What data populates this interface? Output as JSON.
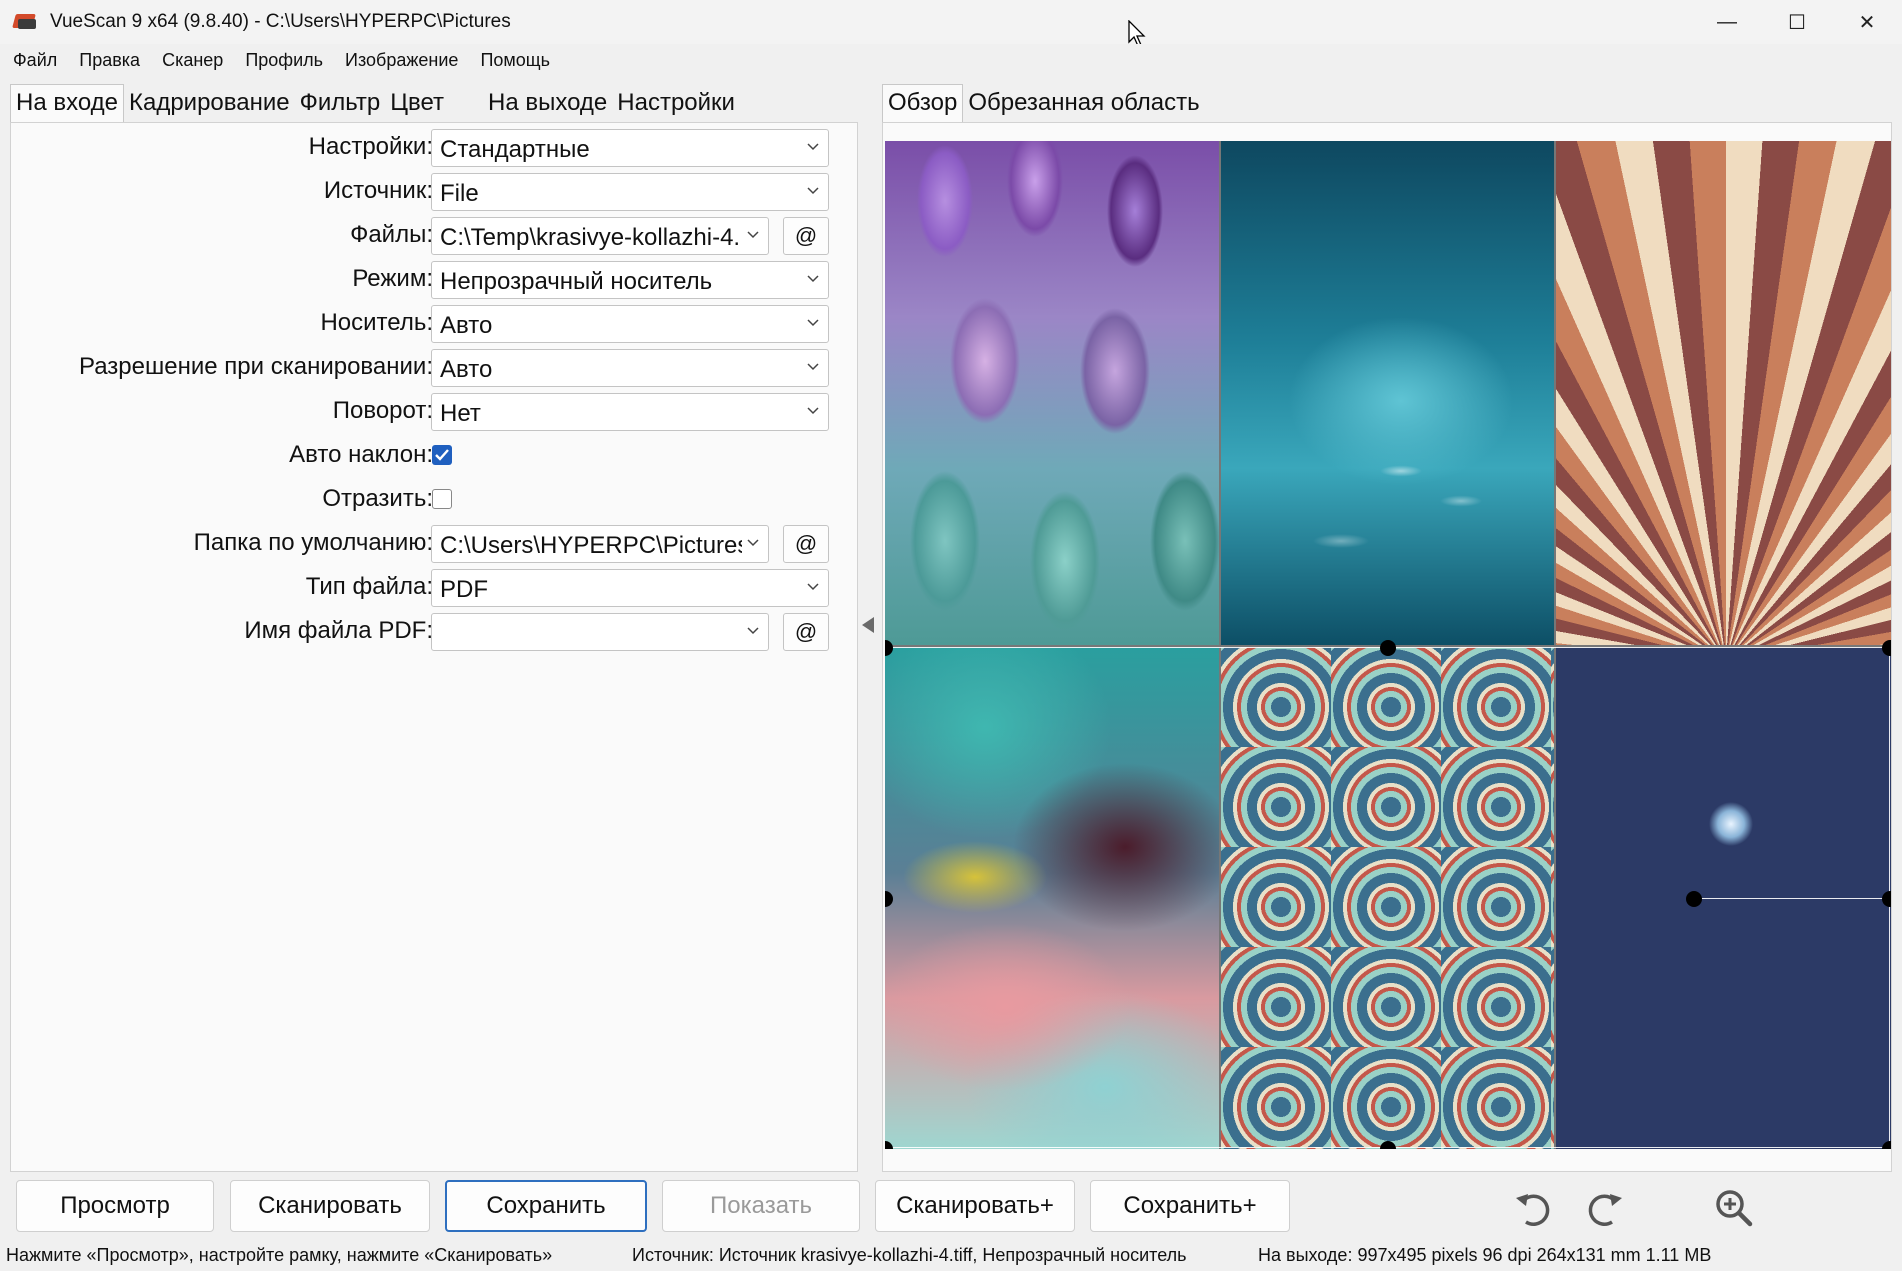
{
  "window": {
    "title": "VueScan 9 x64 (9.8.40) - C:\\Users\\HYPERPC\\Pictures",
    "minimize": "—",
    "maximize": "☐",
    "close": "✕"
  },
  "menu": [
    "Файл",
    "Правка",
    "Сканер",
    "Профиль",
    "Изображение",
    "Помощь"
  ],
  "left_tabs": [
    {
      "label": "На входе",
      "active": true
    },
    {
      "label": "Кадрирование"
    },
    {
      "label": "Фильтр"
    },
    {
      "label": "Цвет"
    },
    {
      "label": "На выходе"
    },
    {
      "label": "Настройки"
    }
  ],
  "right_tabs": [
    {
      "label": "Обзор",
      "active": true
    },
    {
      "label": "Обрезанная область"
    }
  ],
  "form": {
    "settings": {
      "label": "Настройки:",
      "value": "Стандартные"
    },
    "source": {
      "label": "Источник:",
      "value": "File"
    },
    "files": {
      "label": "Файлы:",
      "value": "C:\\Temp\\krasivye-kollazhi-4.",
      "extra": "@"
    },
    "mode": {
      "label": "Режим:",
      "value": "Непрозрачный носитель"
    },
    "media": {
      "label": "Носитель:",
      "value": "Авто"
    },
    "resolution": {
      "label": "Разрешение при сканировании:",
      "value": "Авто"
    },
    "rotation": {
      "label": "Поворот:",
      "value": "Нет"
    },
    "auto_skew": {
      "label": "Авто наклон:",
      "checked": true
    },
    "mirror": {
      "label": "Отразить:",
      "checked": false
    },
    "default_folder": {
      "label": "Папка по умолчанию:",
      "value": "C:\\Users\\HYPERPC\\Pictures",
      "extra": "@"
    },
    "file_type": {
      "label": "Тип файла:",
      "value": "PDF"
    },
    "pdf_name": {
      "label": "Имя файла PDF:",
      "value": "",
      "extra": "@"
    }
  },
  "buttons": {
    "preview": "Просмотр",
    "scan": "Сканировать",
    "save": "Сохранить",
    "show": "Показать",
    "scan_plus": "Сканировать+",
    "save_plus": "Сохранить+"
  },
  "status": {
    "hint": "Нажмите «Просмотр», настройте рамку, нажмите «Сканировать»",
    "source": "Источник: Источник krasivye-kollazhi-4.tiff, Непрозрачный носитель",
    "output": "На выходе: 997x495 pixels 96 dpi 264x131 mm 1.11 MB"
  },
  "icons": {
    "undo": "rotate-left-icon",
    "redo": "rotate-right-icon",
    "zoom": "zoom-in-icon",
    "collapse": "collapse-left-icon"
  },
  "colors": {
    "accent": "#1f5fbf",
    "primary_button_border": "#2e6fbf"
  }
}
